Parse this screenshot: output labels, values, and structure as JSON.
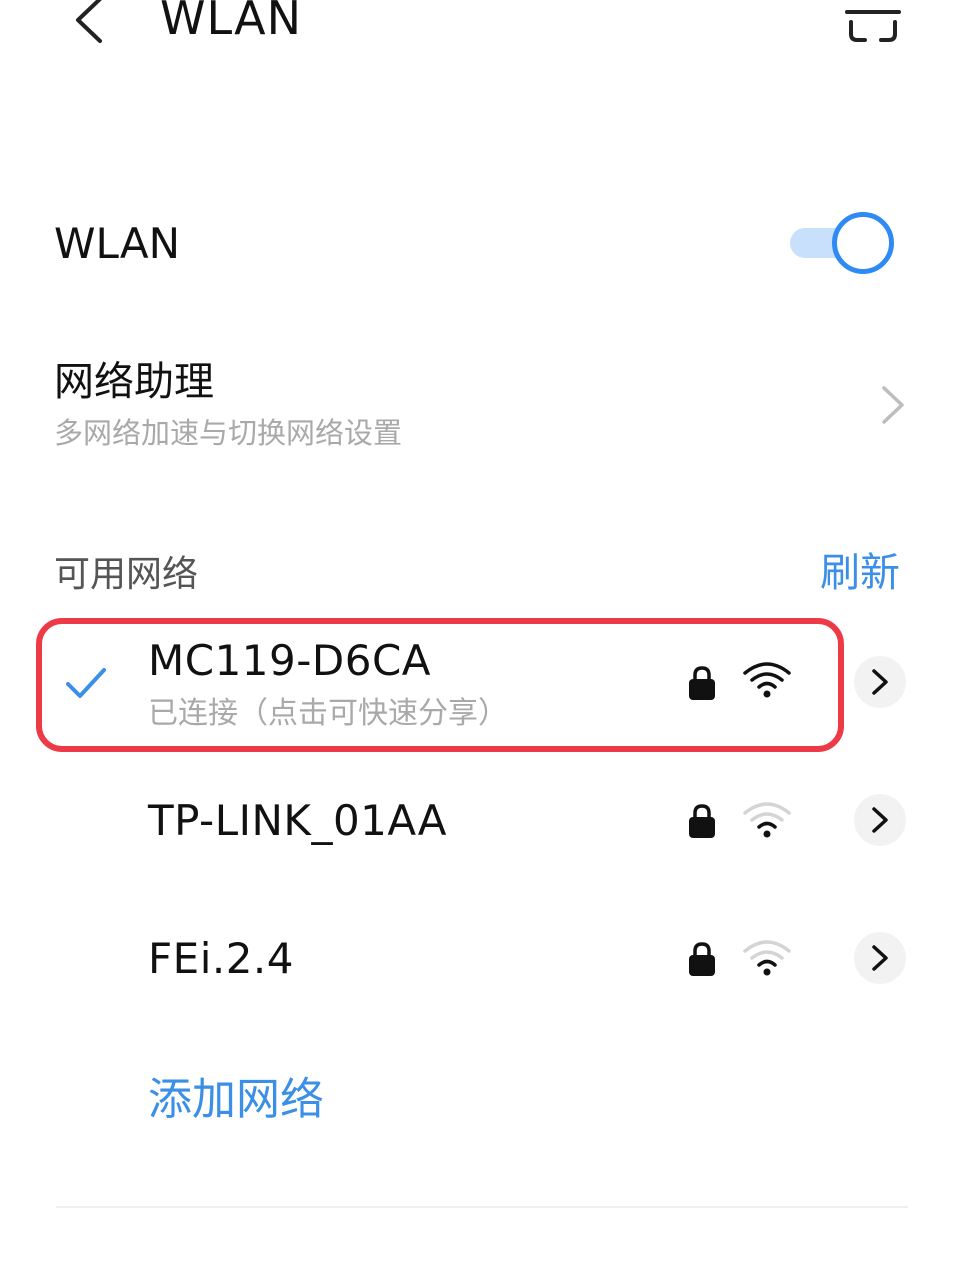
{
  "header": {
    "title": "WLAN",
    "back_icon": "chevron-left-icon",
    "scan_icon": "scan-icon"
  },
  "wlan": {
    "label": "WLAN",
    "enabled": true,
    "accent_color": "#2f8bf3"
  },
  "assistant": {
    "title": "网络助理",
    "subtitle": "多网络加速与切换网络设置"
  },
  "networks_section": {
    "label": "可用网络",
    "refresh_label": "刷新",
    "link_color": "#3b8fe6"
  },
  "networks": [
    {
      "name": "MC119-D6CA",
      "status": "已连接（点击可快速分享）",
      "connected": true,
      "secured": true,
      "signal_bars": 4
    },
    {
      "name": "TP-LINK_01AA",
      "status": "",
      "connected": false,
      "secured": true,
      "signal_bars": 2
    },
    {
      "name": "FEi.2.4",
      "status": "",
      "connected": false,
      "secured": true,
      "signal_bars": 2
    }
  ],
  "add_network_label": "添加网络",
  "highlight_color": "#ee3a46"
}
